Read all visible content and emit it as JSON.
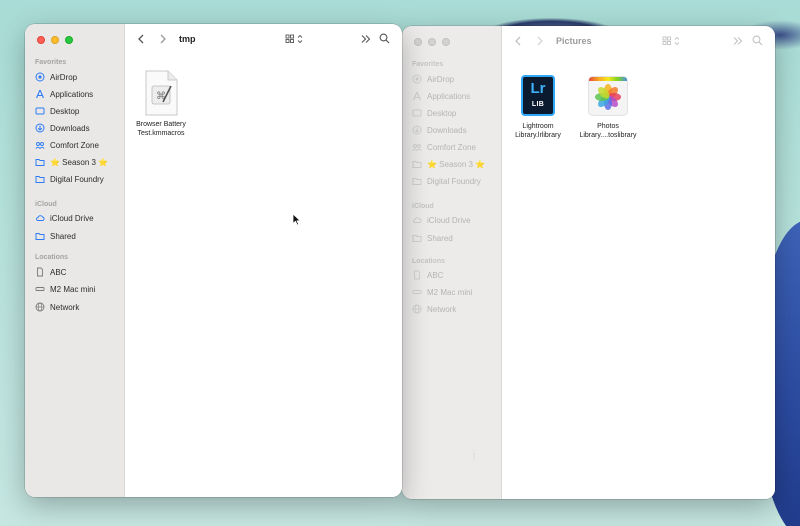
{
  "colors": {
    "accent": "#2f7bf5",
    "close": "#fe5f57",
    "minimize": "#febc2e",
    "zoom": "#28c840"
  },
  "window_left": {
    "title": "tmp",
    "sidebar": {
      "favorites_header": "Favorites",
      "favorites": [
        {
          "label": "AirDrop",
          "icon": "airdrop-icon"
        },
        {
          "label": "Applications",
          "icon": "applications-icon"
        },
        {
          "label": "Desktop",
          "icon": "desktop-icon"
        },
        {
          "label": "Downloads",
          "icon": "downloads-icon"
        },
        {
          "label": "Comfort Zone",
          "icon": "shared-folder-icon"
        },
        {
          "label": "⭐ Season 3 ⭐",
          "icon": "folder-icon"
        },
        {
          "label": "Digital Foundry",
          "icon": "folder-icon"
        }
      ],
      "icloud_header": "iCloud",
      "icloud": [
        {
          "label": "iCloud Drive",
          "icon": "icloud-icon"
        },
        {
          "label": "Shared",
          "icon": "shared-folder-icon"
        }
      ],
      "locations_header": "Locations",
      "locations": [
        {
          "label": "ABC",
          "icon": "document-icon"
        },
        {
          "label": "M2 Mac mini",
          "icon": "mac-mini-icon"
        },
        {
          "label": "Network",
          "icon": "network-icon"
        }
      ]
    },
    "files": [
      {
        "name_line1": "Browser Battery",
        "name_line2": "Test.kmmacros",
        "icon": "kmmacros-file-icon"
      }
    ]
  },
  "window_right": {
    "title": "Pictures",
    "sidebar": {
      "favorites_header": "Favorites",
      "favorites": [
        {
          "label": "AirDrop"
        },
        {
          "label": "Applications"
        },
        {
          "label": "Desktop"
        },
        {
          "label": "Downloads"
        },
        {
          "label": "Comfort Zone"
        },
        {
          "label": "⭐ Season 3 ⭐"
        },
        {
          "label": "Digital Foundry"
        }
      ],
      "icloud_header": "iCloud",
      "icloud": [
        {
          "label": "iCloud Drive"
        },
        {
          "label": "Shared"
        }
      ],
      "locations_header": "Locations",
      "locations": [
        {
          "label": "ABC"
        },
        {
          "label": "M2 Mac mini"
        },
        {
          "label": "Network"
        }
      ]
    },
    "files": [
      {
        "name_line1": "Lightroom",
        "name_line2": "Library.lrlibrary",
        "icon": "lightroom-library-icon",
        "badge_top": "Lr",
        "badge_bottom": "LIB"
      },
      {
        "name_line1": "Photos",
        "name_line2": "Library....toslibrary",
        "icon": "photos-library-icon"
      }
    ]
  }
}
